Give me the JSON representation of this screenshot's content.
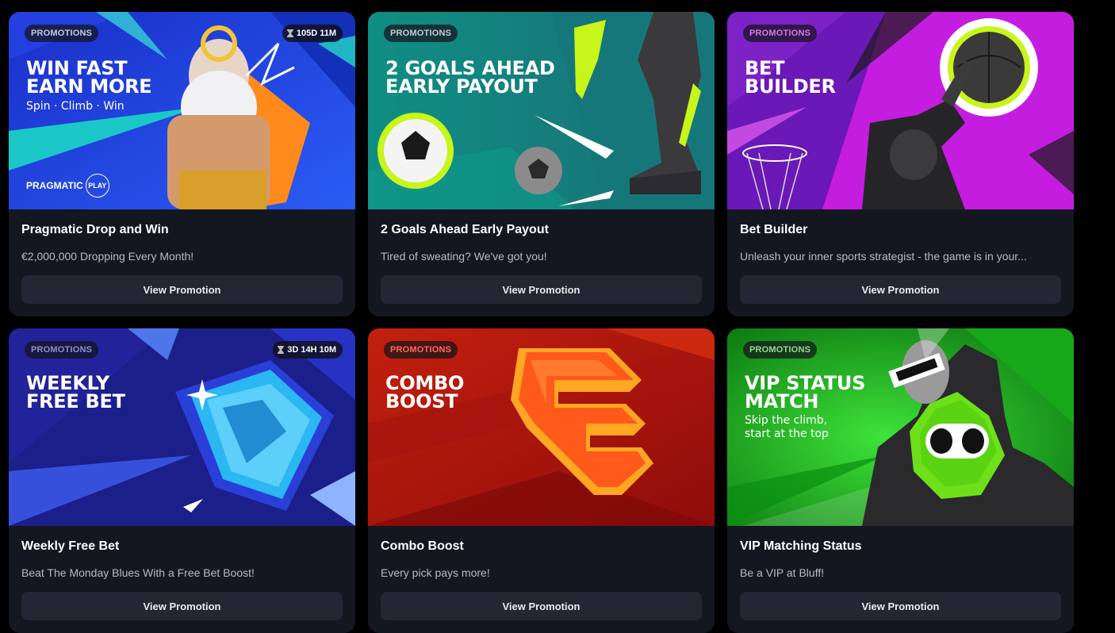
{
  "cards": [
    {
      "tag": "PROMOTIONS",
      "timer": "105D 11M",
      "headline_1": "WIN FAST",
      "headline_2": "EARN MORE",
      "subline": "Spin · Climb · Win",
      "brand_name": "PRAGMATIC",
      "brand_suffix": "PLAY",
      "title": "Pragmatic Drop and Win",
      "description": "€2,000,000 Dropping Every Month!",
      "button": "View Promotion"
    },
    {
      "tag": "PROMOTIONS",
      "headline_1": "2 GOALS AHEAD",
      "headline_2": "EARLY PAYOUT",
      "title": "2 Goals Ahead Early Payout",
      "description": "Tired of sweating? We've got you!",
      "button": "View Promotion"
    },
    {
      "tag": "PROMOTIONS",
      "headline_1": "BET",
      "headline_2": "BUILDER",
      "title": "Bet Builder",
      "description": "Unleash your inner sports strategist - the game is in your...",
      "button": "View Promotion"
    },
    {
      "tag": "PROMOTIONS",
      "timer": "3D 14H 10M",
      "headline_1": "WEEKLY",
      "headline_2": "FREE BET",
      "title": "Weekly Free Bet",
      "description": "Beat The Monday Blues With a Free Bet Boost!",
      "button": "View Promotion"
    },
    {
      "tag": "PROMOTIONS",
      "headline_1": "COMBO",
      "headline_2": "BOOST",
      "title": "Combo Boost",
      "description": "Every pick pays more!",
      "button": "View Promotion"
    },
    {
      "tag": "PROMOTIONS",
      "headline_1": "VIP STATUS",
      "headline_2": "MATCH",
      "subline_1": "Skip the climb,",
      "subline_2": "start at the top",
      "title": "VIP Matching Status",
      "description": "Be a VIP at Bluff!",
      "button": "View Promotion"
    }
  ],
  "colors": {
    "card_bg": "#141620",
    "button_bg": "#232633",
    "pragmatic_banner": "#1e3bd6",
    "goals_banner": "#14857a",
    "bet_builder_banner": "#c81de0",
    "free_bet_banner": "#1b1f8a",
    "combo_banner": "#b3160c",
    "vip_banner": "#1ea81e",
    "accent_lime": "#c8f51a"
  }
}
